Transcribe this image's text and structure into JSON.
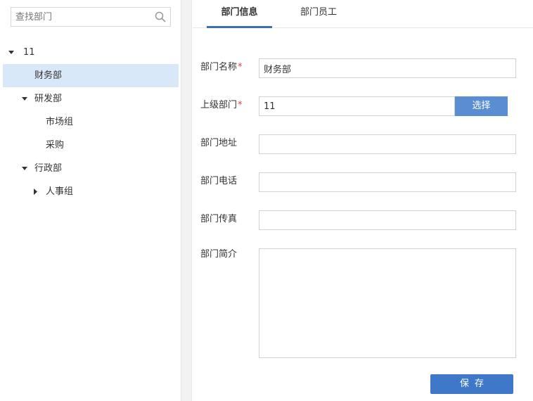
{
  "search": {
    "placeholder": "查找部门",
    "icon": "search-icon"
  },
  "tree": [
    {
      "label": "11",
      "expanded": true,
      "selected": false
    },
    {
      "label": "财务部",
      "expanded": null,
      "selected": true
    },
    {
      "label": "研发部",
      "expanded": true,
      "selected": false
    },
    {
      "label": "市场组",
      "expanded": null,
      "selected": false
    },
    {
      "label": "采购",
      "expanded": null,
      "selected": false
    },
    {
      "label": "行政部",
      "expanded": true,
      "selected": false
    },
    {
      "label": "人事组",
      "expanded": false,
      "selected": false
    }
  ],
  "tabs": [
    {
      "label": "部门信息",
      "active": true
    },
    {
      "label": "部门员工",
      "active": false
    }
  ],
  "form": {
    "name": {
      "label": "部门名称",
      "required_mark": "*",
      "value": "财务部"
    },
    "parent": {
      "label": "上级部门",
      "required_mark": "*",
      "value": "11",
      "button": "选择"
    },
    "address": {
      "label": "部门地址",
      "value": ""
    },
    "phone": {
      "label": "部门电话",
      "value": ""
    },
    "fax": {
      "label": "部门传真",
      "value": ""
    },
    "intro": {
      "label": "部门简介",
      "value": ""
    }
  },
  "save_button": "保存",
  "colors": {
    "accent": "#3f78c9",
    "select_button": "#5b8dd3",
    "selected_row": "#d9e8f9",
    "required": "#e0403a"
  }
}
